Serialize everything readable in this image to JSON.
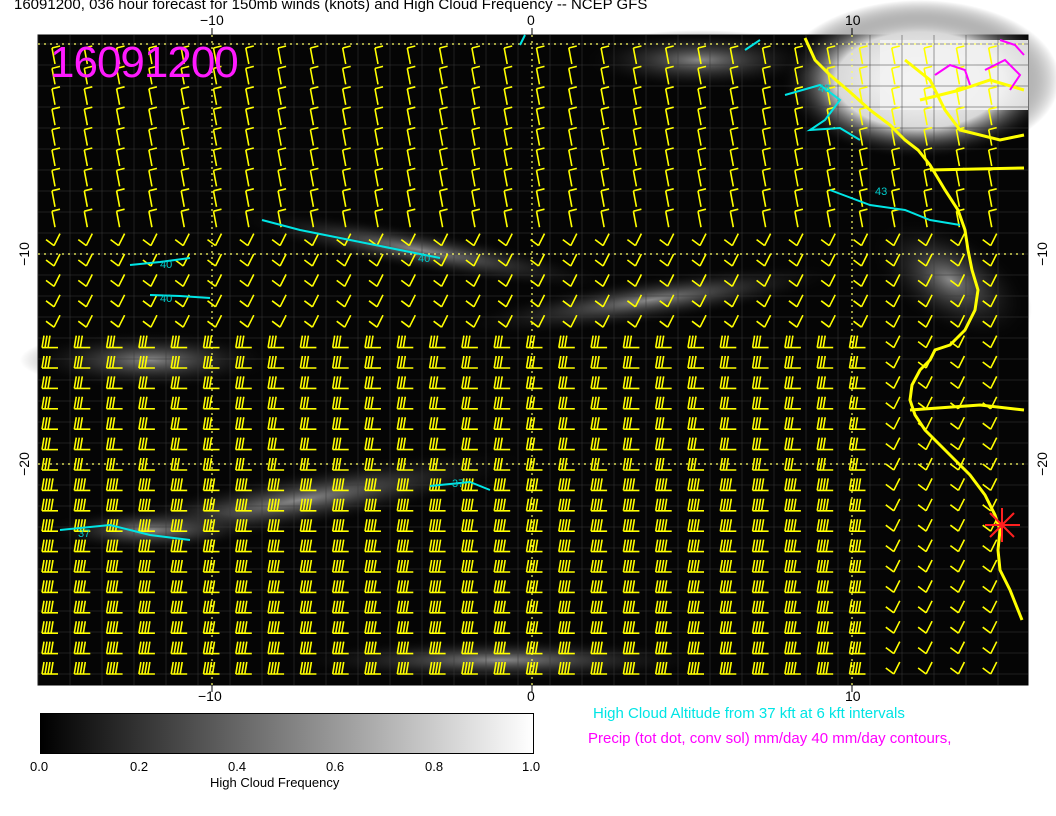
{
  "title": "16091200, 036 hour forecast for 150mb winds (knots) and High Cloud Frequency -- NCEP GFS",
  "stamp": "16091200",
  "colors": {
    "stamp": "#ff1aff",
    "barbs": "#ffff00",
    "coast": "#ffff00",
    "cloud_contours": "#00e5e5",
    "precip_contours": "#ff00ff",
    "grid": "#ffff66",
    "cyclone_marker": "#ff2020"
  },
  "axes": {
    "x_ticks": [
      "−10",
      "0",
      "10"
    ],
    "y_ticks": [
      "−10",
      "−20"
    ]
  },
  "contour_labels": [
    "40",
    "40",
    "40",
    "43",
    "43",
    "37",
    "37"
  ],
  "colorbar": {
    "ticks": [
      "0.0",
      "0.2",
      "0.4",
      "0.6",
      "0.8",
      "1.0"
    ],
    "title": "High Cloud Frequency"
  },
  "notes": {
    "line1": "High Cloud Altitude from 37 kft at 6 kft intervals",
    "line2": "Precip (tot dot, conv sol) mm/day 40 mm/day contours,"
  }
}
